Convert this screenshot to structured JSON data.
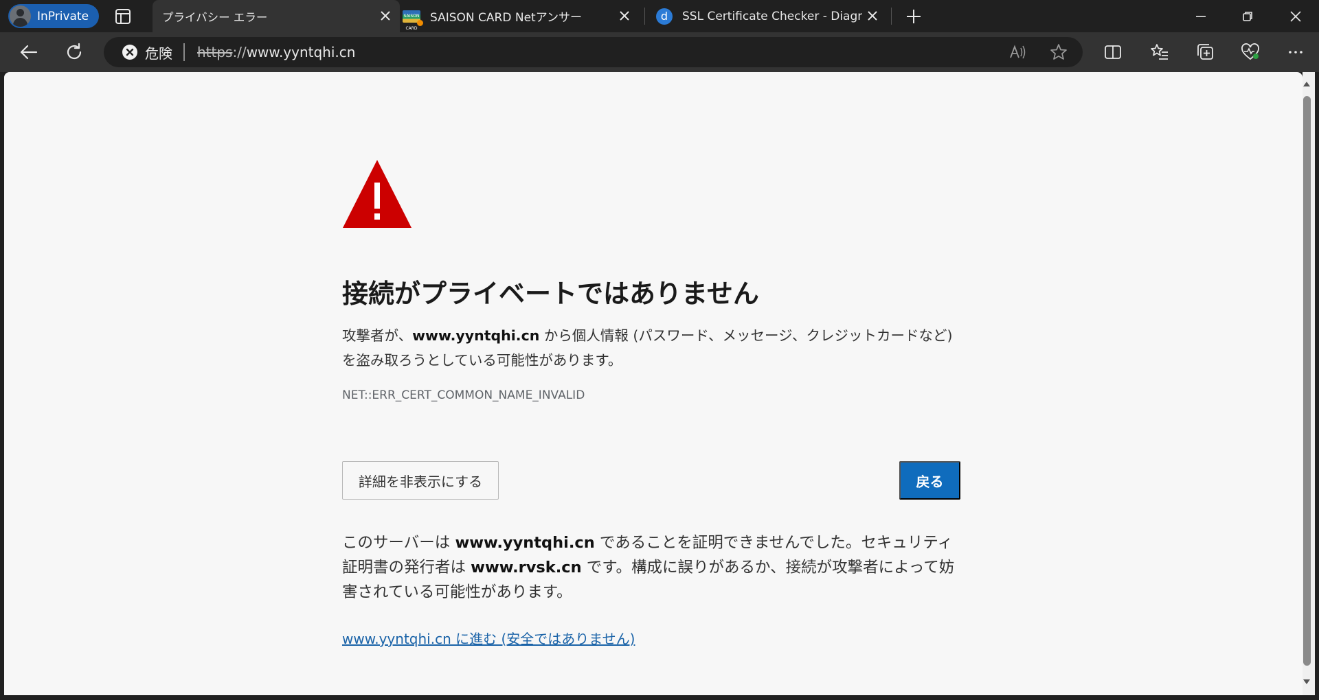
{
  "browser": {
    "inprivate_label": "InPrivate",
    "tabs": [
      {
        "title": "プライバシー エラー",
        "active": true
      },
      {
        "title": "SAISON CARD Netアンサー",
        "active": false,
        "favicon_text": "SAISON CARD"
      },
      {
        "title": "SSL Certificate Checker - Diagnos",
        "active": false,
        "favicon_letter": "d"
      }
    ],
    "security_label": "危険",
    "url": {
      "scheme": "https",
      "separator": "://",
      "host": "www.yyntqhi.cn"
    }
  },
  "page": {
    "title": "接続がプライベートではありません",
    "description": {
      "prefix": "攻撃者が、",
      "host": "www.yyntqhi.cn",
      "suffix": " から個人情報 (パスワード、メッセージ、クレジットカードなど) を盗み取ろうとしている可能性があります。"
    },
    "error_code": "NET::ERR_CERT_COMMON_NAME_INVALID",
    "details_button": "詳細を非表示にする",
    "back_button": "戻る",
    "details": {
      "part1": "このサーバーは ",
      "host": "www.yyntqhi.cn",
      "part2": " であることを証明できませんでした。セキュリティ証明書の発行者は ",
      "issuer": "www.rvsk.cn",
      "part3": " です。構成に誤りがあるか、接続が攻撃者によって妨害されている可能性があります。"
    },
    "proceed_link": "www.yyntqhi.cn に進む (安全ではありません)"
  },
  "colors": {
    "warning_red": "#cc0000",
    "primary_button": "#0f6cbd",
    "link": "#1a63a8",
    "inprivate_badge": "#1b5fb0"
  },
  "icons": [
    "avatar-icon",
    "tab-actions-icon",
    "close-icon",
    "new-tab-icon",
    "minimize-icon",
    "restore-icon",
    "back-icon",
    "refresh-icon",
    "danger-icon",
    "read-aloud-icon",
    "favorite-star-icon",
    "split-screen-icon",
    "favorites-icon",
    "collections-icon",
    "browser-essentials-icon",
    "more-icon",
    "warning-triangle-icon"
  ]
}
